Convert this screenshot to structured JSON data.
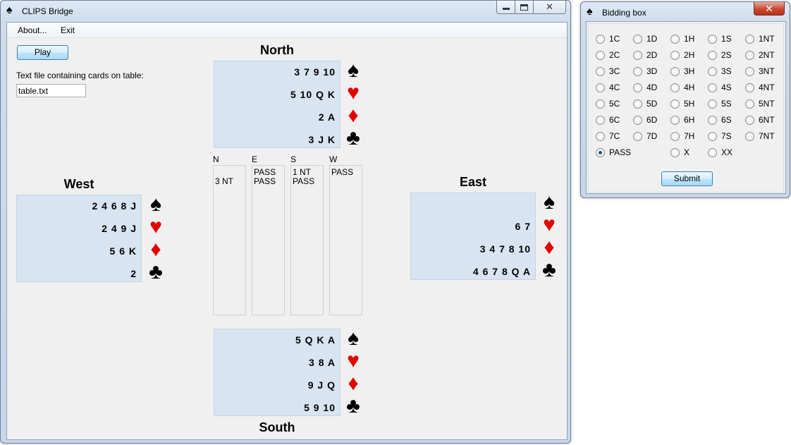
{
  "main_window": {
    "title": "CLIPS Bridge",
    "icon": "spade-icon",
    "menu": [
      "About...",
      "Exit"
    ],
    "play_button": "Play",
    "file_label": "Text file containing cards on table:",
    "file_value": "table.txt"
  },
  "suit_symbols": {
    "spades": "♠",
    "hearts": "♥",
    "diamonds": "♦",
    "clubs": "♣"
  },
  "colors": {
    "black_suit": "#000000",
    "red_suit": "#e00000",
    "hand_panel": "#d8e4f1"
  },
  "hands": {
    "north": {
      "name": "North",
      "spades": "3 7 9 10",
      "hearts": "5 10 Q K",
      "diamonds": "2 A",
      "clubs": "3 J K"
    },
    "west": {
      "name": "West",
      "spades": "2 4 6 8 J",
      "hearts": "2 4 9 J",
      "diamonds": "5 6 K",
      "clubs": "2"
    },
    "east": {
      "name": "East",
      "spades": "",
      "hearts": "6 7",
      "diamonds": "3 4 7 8 10",
      "clubs": "4 6 7 8 Q A"
    },
    "south": {
      "name": "South",
      "spades": "5 Q K A",
      "hearts": "3 8 A",
      "diamonds": "9 J Q",
      "clubs": "5 9 10"
    }
  },
  "auction": {
    "headers": [
      "N",
      "E",
      "S",
      "W"
    ],
    "columns": [
      [
        "3 NT"
      ],
      [
        "PASS",
        "PASS"
      ],
      [
        "1 NT",
        "PASS"
      ],
      [
        "PASS"
      ]
    ]
  },
  "bidding_box": {
    "title": "Bidding box",
    "icon": "spade-icon",
    "rows": [
      [
        "1C",
        "1D",
        "1H",
        "1S",
        "1NT"
      ],
      [
        "2C",
        "2D",
        "2H",
        "2S",
        "2NT"
      ],
      [
        "3C",
        "3D",
        "3H",
        "3S",
        "3NT"
      ],
      [
        "4C",
        "4D",
        "4H",
        "4S",
        "4NT"
      ],
      [
        "5C",
        "5D",
        "5H",
        "5S",
        "5NT"
      ],
      [
        "6C",
        "6D",
        "6H",
        "6S",
        "6NT"
      ],
      [
        "7C",
        "7D",
        "7H",
        "7S",
        "7NT"
      ]
    ],
    "specials": [
      "PASS",
      "X",
      "XX"
    ],
    "selected": "PASS",
    "submit_label": "Submit"
  }
}
